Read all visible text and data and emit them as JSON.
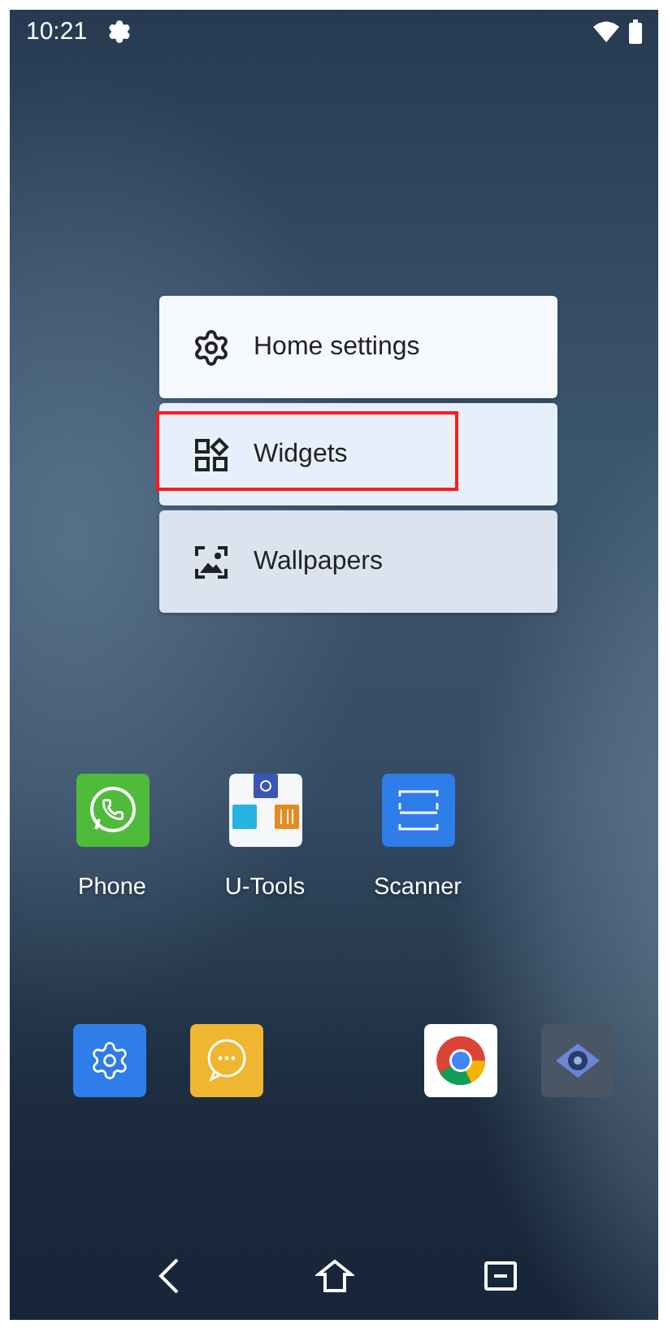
{
  "status_bar": {
    "time": "10:21"
  },
  "menu": {
    "items": [
      {
        "kind": "settings",
        "label": "Home settings",
        "highlighted": false
      },
      {
        "kind": "widgets",
        "label": "Widgets",
        "highlighted": true
      },
      {
        "kind": "wallpapers",
        "label": "Wallpapers",
        "highlighted": false
      }
    ]
  },
  "apps": [
    {
      "kind": "phone",
      "label": "Phone"
    },
    {
      "kind": "tools",
      "label": "U-Tools"
    },
    {
      "kind": "scanner",
      "label": "Scanner"
    }
  ],
  "dock": [
    {
      "kind": "settings"
    },
    {
      "kind": "messages"
    },
    {
      "kind": "empty"
    },
    {
      "kind": "browser"
    },
    {
      "kind": "camera"
    }
  ]
}
